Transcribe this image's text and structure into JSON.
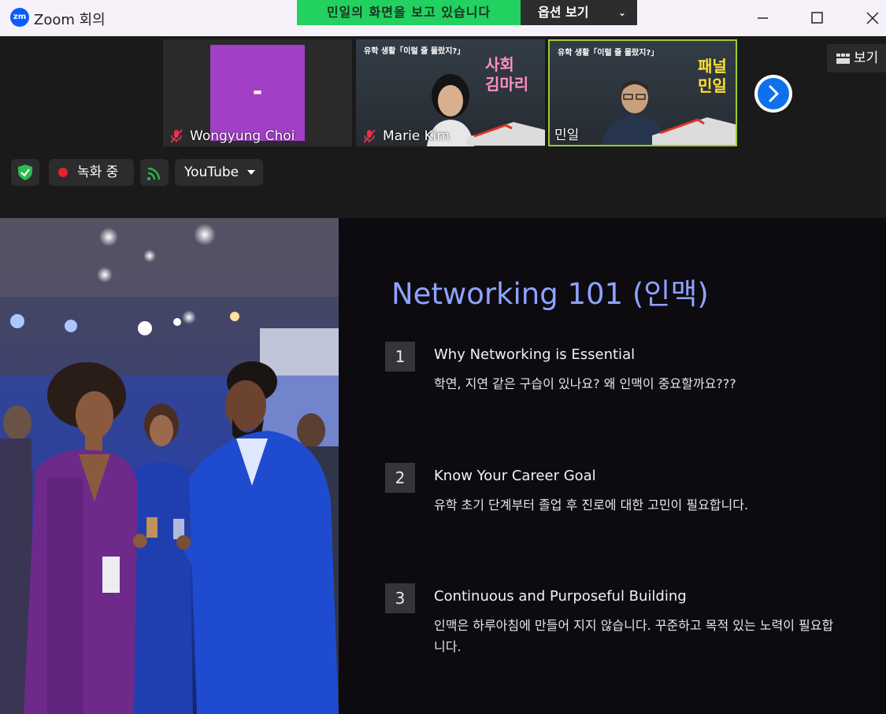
{
  "window": {
    "title": "Zoom 회의",
    "logo": "zm"
  },
  "share": {
    "banner": "민일의 화면을 보고 있습니다",
    "options_label": "옵션 보기"
  },
  "participants": [
    {
      "name": "Wongyung Choi",
      "muted": true,
      "avatar_text": "-"
    },
    {
      "name": "Marie Kim",
      "muted": true,
      "bg_title": "유학 생활「이럴 줄 몰랐지?」",
      "bg_tag": "사회\n김마리"
    },
    {
      "name": "민일",
      "muted": false,
      "bg_title": "유학 생활「이럴 줄 몰랐지?」",
      "bg_tag": "패널\n민일"
    }
  ],
  "toolbar": {
    "recording_label": "녹화 중",
    "stream_label": "YouTube",
    "view_label": "보기"
  },
  "slide": {
    "title": "Networking 101 (인맥)",
    "items": [
      {
        "num": "1",
        "title": "Why Networking is Essential",
        "desc": "학연, 지연 같은 구습이 있나요? 왜 인맥이 중요할까요???"
      },
      {
        "num": "2",
        "title": "Know Your Career Goal",
        "desc": "유학 초기 단계부터 졸업 후 진로에 대한 고민이 필요합니다."
      },
      {
        "num": "3",
        "title": "Continuous and Purposeful Building",
        "desc": "인맥은 하루아침에 만들어 지지 않습니다. 꾸준하고 목적 있는 노력이 필요합니다."
      }
    ]
  },
  "colors": {
    "share_green": "#23d160",
    "zoom_blue": "#0e71eb",
    "slide_title": "#8ea3ff",
    "active_speaker": "#9acd32"
  }
}
